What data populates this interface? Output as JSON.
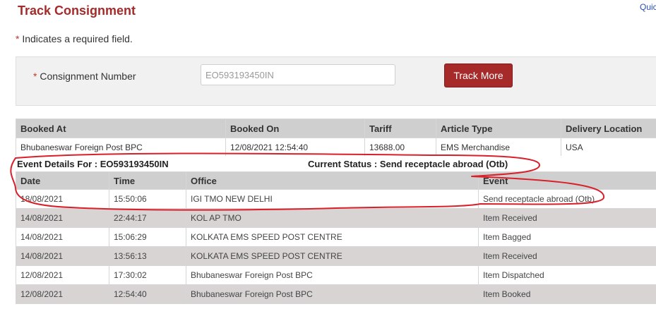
{
  "page": {
    "title": "Track Consignment",
    "quick_link": "Quic",
    "required_star": "*",
    "required_note": "Indicates a required field."
  },
  "form": {
    "label_star": "*",
    "label": "Consignment Number",
    "input_value": "EO593193450IN",
    "button_label": "Track More"
  },
  "booking": {
    "headers": [
      "Booked At",
      "Booked On",
      "Tariff",
      "Article Type",
      "Delivery Location"
    ],
    "row": [
      "Bhubaneswar Foreign Post BPC",
      "12/08/2021 12:54:40",
      "13688.00",
      "EMS Merchandise",
      "USA"
    ]
  },
  "event_details": {
    "for_text": "Event Details For : EO593193450IN",
    "status_text": "Current Status : Send receptacle abroad (Otb)"
  },
  "events": {
    "headers": [
      "Date",
      "Time",
      "Office",
      "Event"
    ],
    "rows": [
      [
        "18/08/2021",
        "15:50:06",
        "IGI TMO NEW DELHI",
        "Send receptacle abroad (Otb)"
      ],
      [
        "14/08/2021",
        "22:44:17",
        "KOL AP TMO",
        "Item Received"
      ],
      [
        "14/08/2021",
        "15:06:29",
        "KOLKATA EMS SPEED POST CENTRE",
        "Item Bagged"
      ],
      [
        "14/08/2021",
        "13:56:13",
        "KOLKATA EMS SPEED POST CENTRE",
        "Item Received"
      ],
      [
        "12/08/2021",
        "17:30:02",
        "Bhubaneswar Foreign Post BPC",
        "Item Dispatched"
      ],
      [
        "12/08/2021",
        "12:54:40",
        "Bhubaneswar Foreign Post BPC",
        "Item Booked"
      ]
    ]
  },
  "colors": {
    "brand": "#a52a2a",
    "button": "#a62a2a",
    "annotation": "#d9202a",
    "header_bg": "#cfcfcf",
    "stripe_bg": "#d8d4d4"
  }
}
